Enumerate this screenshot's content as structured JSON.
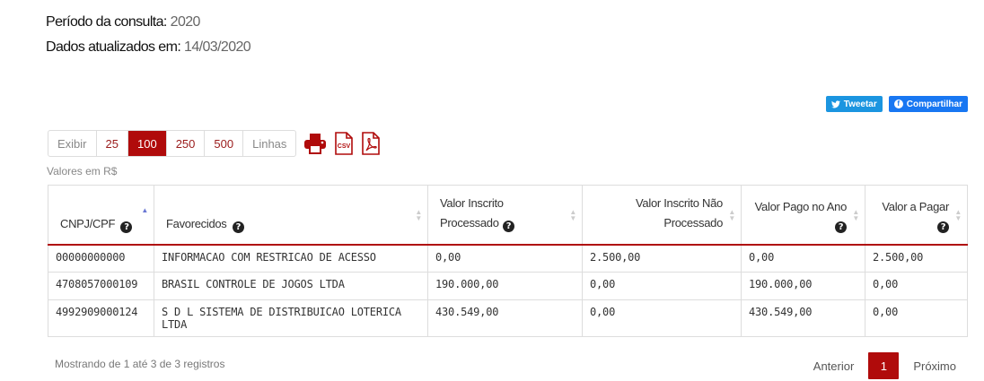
{
  "meta": {
    "period_label": "Período da consulta:",
    "period_value": "2020",
    "updated_label": "Dados atualizados em:",
    "updated_value": "14/03/2020"
  },
  "social": {
    "tweet_label": "Tweetar",
    "share_label": "Compartilhar"
  },
  "toolbar": {
    "show_label": "Exibir",
    "options": [
      "25",
      "100",
      "250",
      "500"
    ],
    "selected": "100",
    "lines_label": "Linhas",
    "csv_label": "CSV"
  },
  "currency_note": "Valores em R$",
  "table": {
    "headers": [
      {
        "label": "CNPJ/CPF",
        "help": true,
        "sorted": "asc"
      },
      {
        "label": "Favorecidos",
        "help": true
      },
      {
        "label": "Valor Inscrito Processado",
        "help": true
      },
      {
        "label": "Valor Inscrito Não Processado",
        "help": false
      },
      {
        "label": "Valor Pago no Ano",
        "help": true
      },
      {
        "label": "Valor a Pagar",
        "help": true
      }
    ],
    "rows": [
      [
        "00000000000",
        "INFORMACAO COM RESTRICAO DE ACESSO",
        "0,00",
        "2.500,00",
        "0,00",
        "2.500,00"
      ],
      [
        "4708057000109",
        "BRASIL CONTROLE DE JOGOS LTDA",
        "190.000,00",
        "0,00",
        "190.000,00",
        "0,00"
      ],
      [
        "4992909000124",
        "S D L SISTEMA DE DISTRIBUICAO LOTERICA LTDA",
        "430.549,00",
        "0,00",
        "430.549,00",
        "0,00"
      ]
    ]
  },
  "footer": {
    "info": "Mostrando de 1 até 3 de 3 registros",
    "prev": "Anterior",
    "current_page": "1",
    "next": "Próximo"
  },
  "colors": {
    "accent": "#b00b0b",
    "twitter": "#1b95e0",
    "facebook": "#1877f2"
  },
  "icons": [
    "twitter-icon",
    "facebook-icon",
    "print-icon",
    "csv-icon",
    "pdf-icon",
    "help-icon",
    "sort-icon"
  ]
}
